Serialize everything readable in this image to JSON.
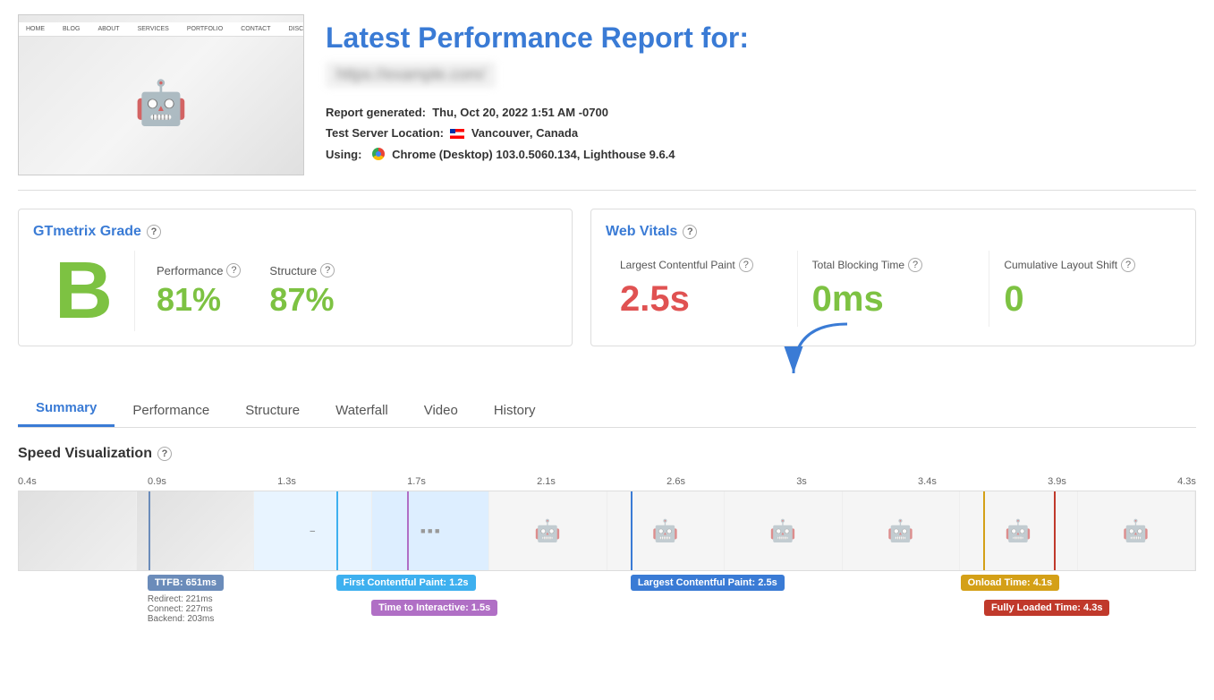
{
  "header": {
    "title": "Latest Performance Report for:",
    "url": "https://example.com/",
    "report_generated_label": "Report generated:",
    "report_generated_value": "Thu, Oct 20, 2022 1:51 AM -0700",
    "server_location_label": "Test Server Location:",
    "server_location_value": "Vancouver, Canada",
    "using_label": "Using:",
    "using_value": "Chrome (Desktop) 103.0.5060.134, Lighthouse 9.6.4"
  },
  "grade_section": {
    "title": "GTmetrix Grade",
    "grade_letter": "B",
    "performance_label": "Performance",
    "performance_value": "81%",
    "structure_label": "Structure",
    "structure_value": "87%"
  },
  "web_vitals": {
    "title": "Web Vitals",
    "lcp_label": "Largest Contentful Paint",
    "lcp_value": "2.5s",
    "tbt_label": "Total Blocking Time",
    "tbt_value": "0ms",
    "cls_label": "Cumulative Layout Shift",
    "cls_value": "0"
  },
  "tabs": [
    {
      "id": "summary",
      "label": "Summary",
      "active": true
    },
    {
      "id": "performance",
      "label": "Performance",
      "active": false
    },
    {
      "id": "structure",
      "label": "Structure",
      "active": false
    },
    {
      "id": "waterfall",
      "label": "Waterfall",
      "active": false
    },
    {
      "id": "video",
      "label": "Video",
      "active": false
    },
    {
      "id": "history",
      "label": "History",
      "active": false
    }
  ],
  "speed_visualization": {
    "title": "Speed Visualization",
    "markers": [
      "0.4s",
      "0.9s",
      "1.3s",
      "1.7s",
      "2.1s",
      "2.6s",
      "3s",
      "3.4s",
      "3.9s",
      "4.3s"
    ],
    "labels": {
      "ttfb": "TTFB: 651ms",
      "ttfb_sub1": "Redirect: 221ms",
      "ttfb_sub2": "Connect: 227ms",
      "ttfb_sub3": "Backend: 203ms",
      "fcp": "First Contentful Paint: 1.2s",
      "tti": "Time to Interactive: 1.5s",
      "lcp": "Largest Contentful Paint: 2.5s",
      "onload": "Onload Time: 4.1s",
      "flt": "Fully Loaded Time: 4.3s"
    }
  },
  "question_mark": "?"
}
